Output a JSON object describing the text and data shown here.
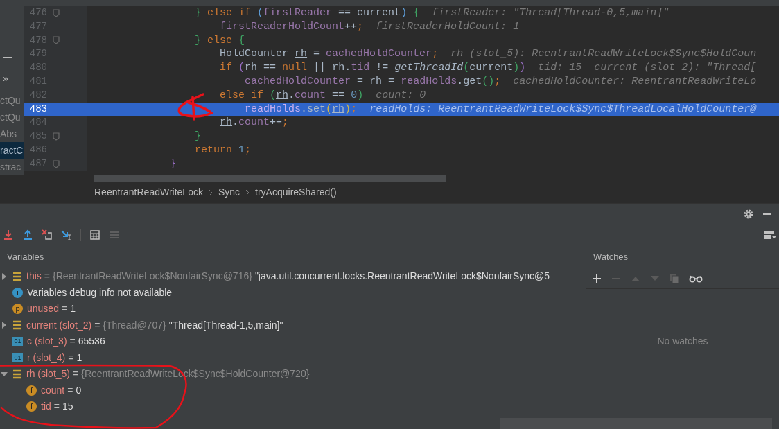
{
  "project_tree": {
    "collapse_glyph": "—",
    "more_glyph": "»",
    "items": [
      {
        "label": "ctQu",
        "selected": false
      },
      {
        "label": "ctQu",
        "selected": false
      },
      {
        "label": "Abs",
        "selected": false
      },
      {
        "label": "ractC",
        "selected": true
      },
      {
        "label": "strac",
        "selected": false
      }
    ]
  },
  "editor": {
    "lines": [
      {
        "number": "476",
        "fold": true,
        "current": false,
        "tokens": [
          {
            "kind": "brace",
            "t": "                }"
          },
          {
            "kind": "keyword",
            "t": " else if "
          },
          {
            "kind": "paren",
            "t": "("
          },
          {
            "kind": "field",
            "t": "firstReader"
          },
          {
            "kind": "plain",
            "t": " == current"
          },
          {
            "kind": "paren",
            "t": ")"
          },
          {
            "kind": "brace",
            "t": " {"
          }
        ],
        "hints": [
          "firstReader: \"Thread[Thread-0,5,main]\""
        ]
      },
      {
        "number": "477",
        "fold": false,
        "current": false,
        "tokens": [
          {
            "kind": "field",
            "t": "                    firstReaderHoldCount"
          },
          {
            "kind": "plain",
            "t": "++"
          },
          {
            "kind": "keyword",
            "t": ";"
          }
        ],
        "hints": [
          "firstReaderHoldCount: 1"
        ]
      },
      {
        "number": "478",
        "fold": true,
        "current": false,
        "tokens": [
          {
            "kind": "brace",
            "t": "                }"
          },
          {
            "kind": "keyword",
            "t": " else "
          },
          {
            "kind": "brace",
            "t": "{"
          }
        ]
      },
      {
        "number": "479",
        "fold": false,
        "current": false,
        "tokens": [
          {
            "kind": "plain",
            "t": "                    HoldCounter "
          },
          {
            "kind": "local",
            "t": "rh"
          },
          {
            "kind": "plain",
            "t": " = "
          },
          {
            "kind": "field",
            "t": "cachedHoldCounter"
          },
          {
            "kind": "keyword",
            "t": ";"
          }
        ],
        "hints": [
          "rh (slot_5): ReentrantReadWriteLock$Sync$HoldCoun"
        ]
      },
      {
        "number": "480",
        "fold": false,
        "current": false,
        "tokens": [
          {
            "kind": "keyword",
            "t": "                    if "
          },
          {
            "kind": "outer-paren",
            "t": "("
          },
          {
            "kind": "local",
            "t": "rh"
          },
          {
            "kind": "plain",
            "t": " == "
          },
          {
            "kind": "keyword",
            "t": "null"
          },
          {
            "kind": "plain",
            "t": " || "
          },
          {
            "kind": "local",
            "t": "rh"
          },
          {
            "kind": "plain",
            "t": "."
          },
          {
            "kind": "field",
            "t": "tid"
          },
          {
            "kind": "plain",
            "t": " != "
          },
          {
            "kind": "call",
            "t": "getThreadId"
          },
          {
            "kind": "brace",
            "t": "("
          },
          {
            "kind": "plain",
            "t": "current"
          },
          {
            "kind": "brace",
            "t": ")"
          },
          {
            "kind": "outer-paren",
            "t": ")"
          }
        ],
        "hints": [
          "tid: 15",
          "current (slot_2): \"Thread["
        ]
      },
      {
        "number": "481",
        "fold": false,
        "current": false,
        "tokens": [
          {
            "kind": "field",
            "t": "                        cachedHoldCounter"
          },
          {
            "kind": "plain",
            "t": " = "
          },
          {
            "kind": "local",
            "t": "rh"
          },
          {
            "kind": "plain",
            "t": " = "
          },
          {
            "kind": "field",
            "t": "readHolds"
          },
          {
            "kind": "plain",
            "t": ".get"
          },
          {
            "kind": "brace",
            "t": "()"
          },
          {
            "kind": "keyword",
            "t": ";"
          }
        ],
        "hints": [
          "cachedHoldCounter: ReentrantReadWriteLo"
        ]
      },
      {
        "number": "482",
        "fold": false,
        "current": false,
        "tokens": [
          {
            "kind": "keyword",
            "t": "                    else if "
          },
          {
            "kind": "brace",
            "t": "("
          },
          {
            "kind": "local",
            "t": "rh"
          },
          {
            "kind": "plain",
            "t": "."
          },
          {
            "kind": "field",
            "t": "count"
          },
          {
            "kind": "plain",
            "t": " == "
          },
          {
            "kind": "number",
            "t": "0"
          },
          {
            "kind": "brace",
            "t": ")"
          }
        ],
        "hints": [
          "count: 0"
        ]
      },
      {
        "number": "483",
        "fold": false,
        "current": true,
        "tokens": [
          {
            "kind": "field",
            "t": "                        readHolds"
          },
          {
            "kind": "plain",
            "t": ".set"
          },
          {
            "kind": "arg-paren",
            "t": "("
          },
          {
            "kind": "local",
            "t": "rh"
          },
          {
            "kind": "arg-paren",
            "t": ")"
          },
          {
            "kind": "keyword",
            "t": ";"
          }
        ],
        "hints": [
          "readHolds: ReentrantReadWriteLock$Sync$ThreadLocalHoldCounter@"
        ]
      },
      {
        "number": "484",
        "fold": false,
        "current": false,
        "tokens": [
          {
            "kind": "local",
            "t": "                    rh"
          },
          {
            "kind": "plain",
            "t": "."
          },
          {
            "kind": "field",
            "t": "count"
          },
          {
            "kind": "plain",
            "t": "++"
          },
          {
            "kind": "keyword",
            "t": ";"
          }
        ]
      },
      {
        "number": "485",
        "fold": true,
        "current": false,
        "tokens": [
          {
            "kind": "brace",
            "t": "                }"
          }
        ]
      },
      {
        "number": "486",
        "fold": false,
        "current": false,
        "tokens": [
          {
            "kind": "keyword",
            "t": "                return "
          },
          {
            "kind": "number",
            "t": "1"
          },
          {
            "kind": "keyword",
            "t": ";"
          }
        ]
      },
      {
        "number": "487",
        "fold": true,
        "current": false,
        "tokens": [
          {
            "kind": "outer-paren",
            "t": "            }"
          }
        ]
      }
    ]
  },
  "breadcrumbs": [
    "ReentrantReadWriteLock",
    "Sync",
    "tryAcquireShared()"
  ],
  "variables": {
    "title": "Variables",
    "rows": [
      {
        "kind": "object",
        "expandable": true,
        "expanded": false,
        "name": "this",
        "equals": "=",
        "type": "{ReentrantReadWriteLock$NonfairSync@716}",
        "value": "\"java.util.concurrent.locks.ReentrantReadWriteLock$NonfairSync@5"
      },
      {
        "kind": "info",
        "icon_text": "i",
        "expandable": false,
        "value": "Variables debug info not available"
      },
      {
        "kind": "param",
        "icon_text": "p",
        "expandable": false,
        "name": "unused",
        "equals": "=",
        "value": "1"
      },
      {
        "kind": "object",
        "expandable": true,
        "expanded": false,
        "name": "current (slot_2)",
        "equals": "=",
        "type": "{Thread@707}",
        "value": "\"Thread[Thread-1,5,main]\""
      },
      {
        "kind": "primitive",
        "icon_text": "01",
        "expandable": false,
        "name": "c (slot_3)",
        "equals": "=",
        "value": "65536"
      },
      {
        "kind": "primitive",
        "icon_text": "01",
        "expandable": false,
        "name": "r (slot_4)",
        "equals": "=",
        "value": "1"
      },
      {
        "kind": "object",
        "expandable": true,
        "expanded": true,
        "name": "rh (slot_5)",
        "equals": "=",
        "type": "{ReentrantReadWriteLock$Sync$HoldCounter@720}",
        "children": [
          {
            "kind": "field",
            "icon_text": "f",
            "expandable": false,
            "name": "count",
            "equals": "=",
            "value": "0"
          },
          {
            "kind": "field",
            "icon_text": "f",
            "expandable": false,
            "name": "tid",
            "equals": "=",
            "value": "15"
          }
        ]
      }
    ]
  },
  "watches": {
    "title": "Watches",
    "empty_text": "No watches"
  }
}
